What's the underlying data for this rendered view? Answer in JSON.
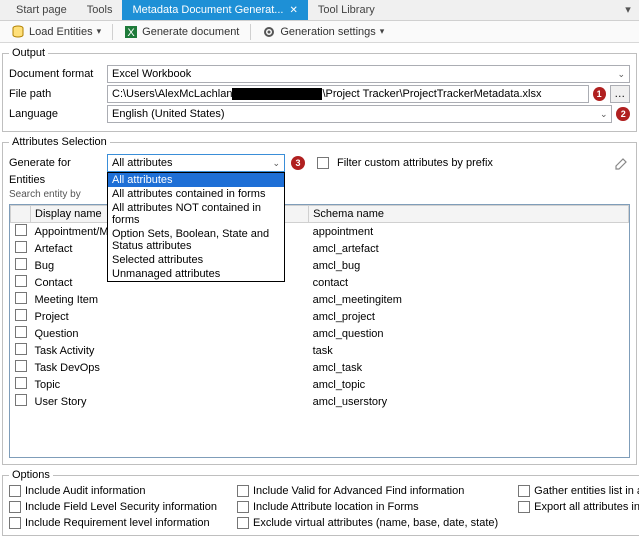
{
  "tabs": {
    "start": "Start page",
    "tools": "Tools",
    "active": "Metadata Document Generat...",
    "library": "Tool Library"
  },
  "toolbar": {
    "load": "Load Entities",
    "generate": "Generate document",
    "settings": "Generation settings"
  },
  "output": {
    "legend": "Output",
    "doc_format_label": "Document format",
    "doc_format_value": "Excel Workbook",
    "file_path_label": "File path",
    "file_path_prefix": "C:\\Users\\AlexMcLachlan",
    "file_path_suffix": "\\Project Tracker\\ProjectTrackerMetadata.xlsx",
    "language_label": "Language",
    "language_value": "English (United States)",
    "badge1": "1",
    "badge2": "2",
    "badge3": "3"
  },
  "attributes": {
    "legend": "Attributes Selection",
    "generate_for_label": "Generate for",
    "generate_for_value": "All attributes",
    "dropdown_options": [
      "All attributes",
      "All attributes contained in forms",
      "All attributes NOT contained in forms",
      "Option Sets, Boolean, State and Status attributes",
      "Selected attributes",
      "Unmanaged attributes"
    ],
    "filter_prefix_label": "Filter custom attributes by prefix",
    "entities_label": "Entities",
    "search_label": "Search entity by",
    "col_display": "Display name",
    "col_schema": "Schema name",
    "rows": [
      {
        "display": "Appointment/Meeting",
        "schema": "appointment"
      },
      {
        "display": "Artefact",
        "schema": "amcl_artefact"
      },
      {
        "display": "Bug",
        "schema": "amcl_bug"
      },
      {
        "display": "Contact",
        "schema": "contact"
      },
      {
        "display": "Meeting Item",
        "schema": "amcl_meetingitem"
      },
      {
        "display": "Project",
        "schema": "amcl_project"
      },
      {
        "display": "Question",
        "schema": "amcl_question"
      },
      {
        "display": "Task Activity",
        "schema": "task"
      },
      {
        "display": "Task DevOps",
        "schema": "amcl_task"
      },
      {
        "display": "Topic",
        "schema": "amcl_topic"
      },
      {
        "display": "User Story",
        "schema": "amcl_userstory"
      }
    ]
  },
  "options": {
    "legend": "Options",
    "c1": {
      "a": "Include Audit information",
      "b": "Include Field Level Security information",
      "c": "Include Requirement level information"
    },
    "c2": {
      "a": "Include Valid for Advanced Find information",
      "b": "Include Attribute location in Forms",
      "c": "Exclude virtual attributes (name, base, date, state)"
    },
    "c3": {
      "a": "Gather entities list in a summary (Excel only)",
      "b": "Export all attributes in one sheet (Excel only)"
    }
  }
}
